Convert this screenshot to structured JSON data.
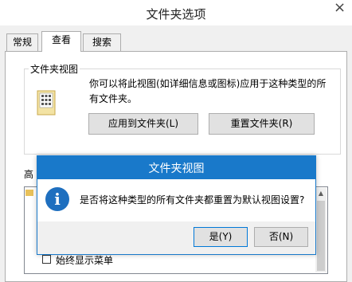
{
  "window": {
    "title": "文件夹选项"
  },
  "tabs": [
    {
      "label": "常规",
      "active": false
    },
    {
      "label": "查看",
      "active": true
    },
    {
      "label": "搜索",
      "active": false
    }
  ],
  "folder_views": {
    "legend": "文件夹视图",
    "description_line1": "你可以将此视图(如详细信息或图标)应用于这种类型的所",
    "description_line2": "有文件夹。",
    "apply_button": "应用到文件夹(L)",
    "reset_button": "重置文件夹(R)"
  },
  "advanced": {
    "label_visible": "高",
    "checkbox_label": "始终显示菜单",
    "checkbox_checked": false
  },
  "dialog": {
    "title": "文件夹视图",
    "icon": "info-icon",
    "message": "是否将这种类型的所有文件夹都重置为默认视图设置?",
    "yes_button": "是(Y)",
    "no_button": "否(N)"
  },
  "colors": {
    "dialog_title_bar": "#1979ca",
    "info_icon": "#1e6fbf"
  }
}
